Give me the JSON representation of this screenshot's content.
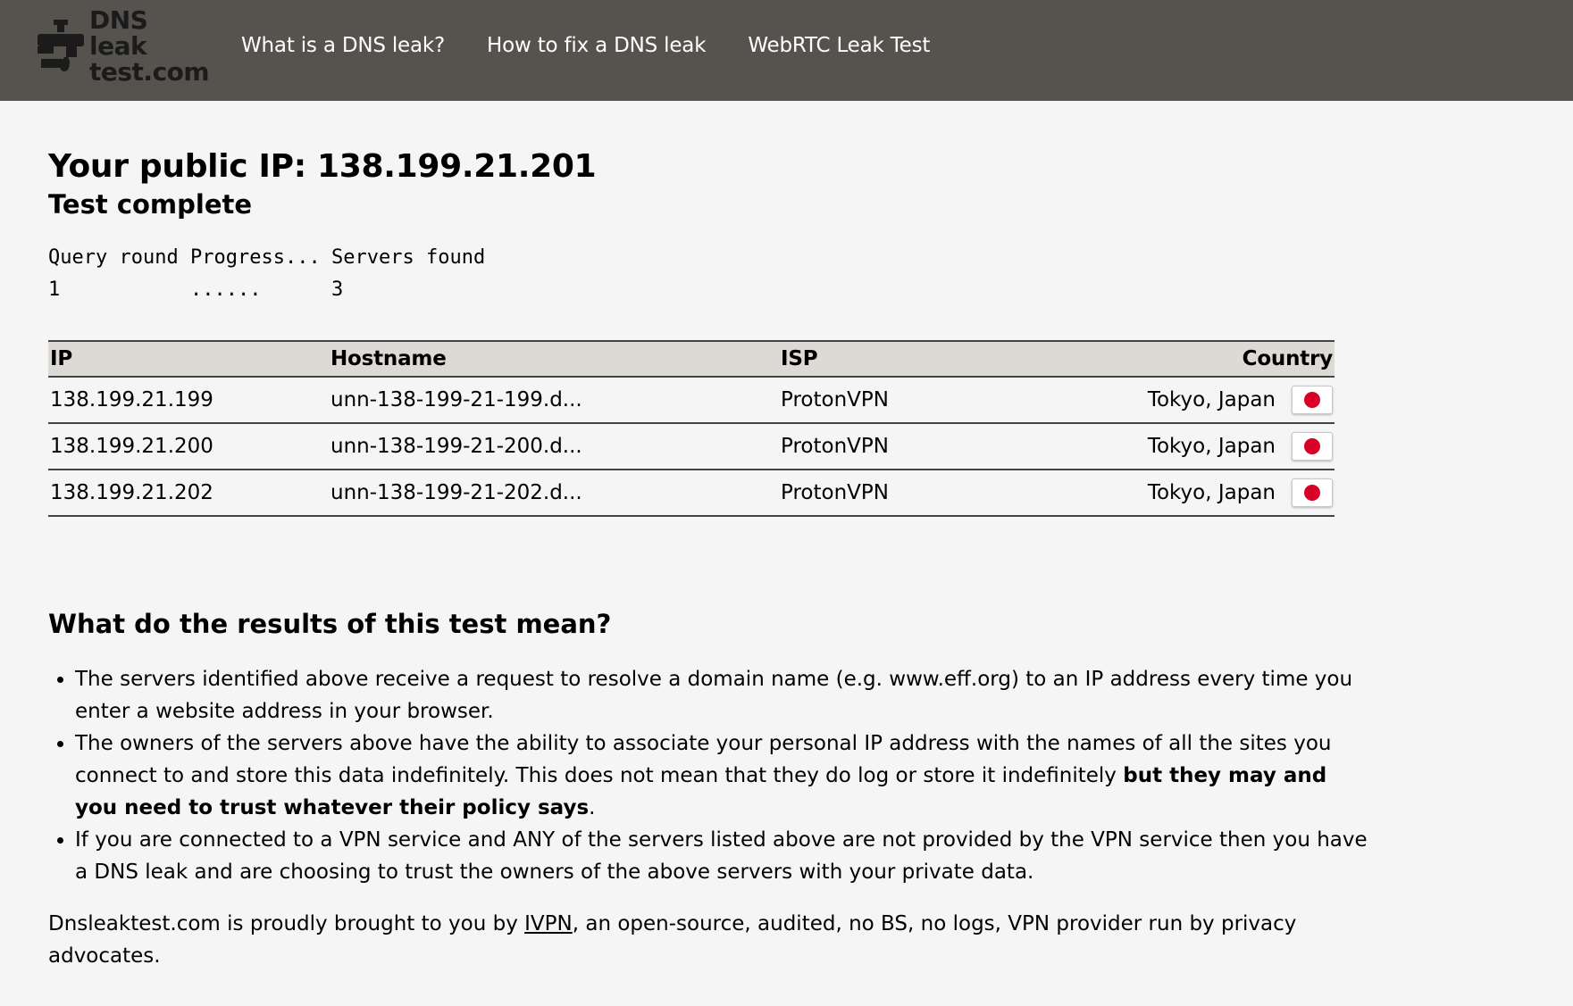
{
  "header": {
    "logo_line1": "DNS leak",
    "logo_line2": "test.com",
    "nav": [
      "What is a DNS leak?",
      "How to fix a DNS leak",
      "WebRTC Leak Test"
    ]
  },
  "main": {
    "ip_title": "Your public IP: 138.199.21.201",
    "status": "Test complete",
    "progress": {
      "headers": [
        "Query round",
        "Progress...",
        "Servers found"
      ],
      "values": [
        "1",
        "......",
        "3"
      ]
    },
    "table": {
      "headers": {
        "ip": "IP",
        "hostname": "Hostname",
        "isp": "ISP",
        "country": "Country"
      },
      "rows": [
        {
          "ip": "138.199.21.199",
          "hostname": "unn-138-199-21-199.d...",
          "isp": "ProtonVPN",
          "location": "Tokyo, Japan",
          "flag": "japan-flag-icon"
        },
        {
          "ip": "138.199.21.200",
          "hostname": "unn-138-199-21-200.d...",
          "isp": "ProtonVPN",
          "location": "Tokyo, Japan",
          "flag": "japan-flag-icon"
        },
        {
          "ip": "138.199.21.202",
          "hostname": "unn-138-199-21-202.d...",
          "isp": "ProtonVPN",
          "location": "Tokyo, Japan",
          "flag": "japan-flag-icon"
        }
      ]
    },
    "explain": {
      "title": "What do the results of this test mean?",
      "point1": "The servers identified above receive a request to resolve a domain name (e.g. www.eff.org) to an IP address every time you enter a website address in your browser.",
      "point2_text": "The owners of the servers above have the ability to associate your personal IP address with the names of all the sites you connect to and store this data indefinitely. This does not mean that they do log or store it indefinitely ",
      "point2_bold": "but they may and you need to trust whatever their policy says",
      "point2_end": ".",
      "point3": "If you are connected to a VPN service and ANY of the servers listed above are not provided by the VPN service then you have a DNS leak and are choosing to trust the owners of the above servers with your private data."
    },
    "footer": {
      "before": "Dnsleaktest.com is proudly brought to you by ",
      "link": "IVPN",
      "after": ", an open-source, audited, no BS, no logs, VPN provider run by privacy advocates."
    }
  },
  "colors": {
    "header_bg": "#56534f",
    "page_bg": "#f5f5f5",
    "table_header_bg": "#dddad5",
    "flag_red": "#d80027"
  }
}
